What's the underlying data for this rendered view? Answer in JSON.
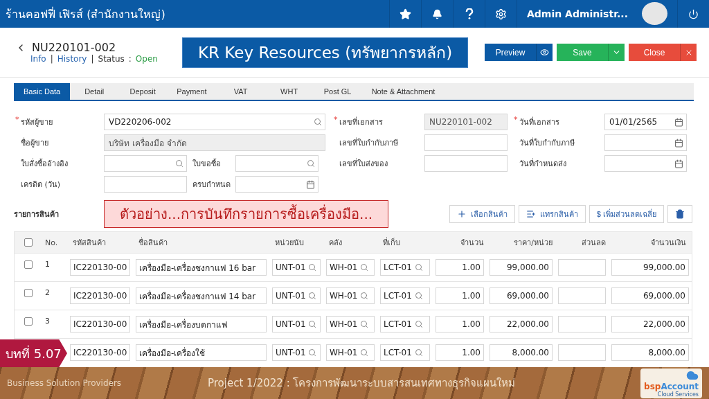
{
  "app_bar": {
    "company": "ร้านคอฟฟี่ เฟิรส์ (สำนักงานใหญ่)",
    "user": "Admin Administr..."
  },
  "header": {
    "doc_no": "NU220101-002",
    "links": [
      "Info",
      "History"
    ],
    "separator": "|",
    "status_label": "Status",
    "colon": ":",
    "status": "Open",
    "banner": "KR Key Resources (ทรัพยากรหลัก)",
    "buttons": [
      {
        "label": "Preview",
        "kind": "primary"
      },
      {
        "label": "Save",
        "kind": "success"
      },
      {
        "label": "Close",
        "kind": "danger"
      }
    ]
  },
  "tabs": [
    {
      "label": "Basic Data",
      "selected": true
    },
    {
      "label": "Detail",
      "selected": false
    },
    {
      "label": "Deposit",
      "selected": false
    },
    {
      "label": "Payment",
      "selected": false
    },
    {
      "label": "VAT",
      "selected": false
    },
    {
      "label": "WHT",
      "selected": false
    },
    {
      "label": "Post GL",
      "selected": false
    },
    {
      "label": "Note & Attachment",
      "selected": false
    }
  ],
  "form": {
    "required_mark": "*",
    "rows": [
      {
        "left": [
          {
            "label": "รหัสผู้ขาย",
            "value": "VD220206-002",
            "required": true,
            "readonly": false,
            "kind": "search"
          }
        ],
        "middle": {
          "label": "เลขที่เอกสาร",
          "value": "NU220101-002",
          "required": true,
          "readonly": true
        },
        "right": {
          "label": "วันที่เอกสาร",
          "value": "01/01/2565",
          "required": true,
          "readonly": false,
          "kind": "calendar"
        }
      },
      {
        "left": [
          {
            "label": "ชื่อผู้ขาย",
            "value": "บริษัท เครื่องมือ จำกัด",
            "required": false,
            "readonly": true
          }
        ],
        "middle": {
          "label": "เลขที่ใบกำกับภาษี",
          "required": false,
          "readonly": false
        },
        "right": {
          "label": "วันที่ใบกำกับภาษี",
          "required": false,
          "readonly": false,
          "kind": "calendar"
        }
      },
      {
        "left": [
          {
            "label": "ใบสั่งซื้ออ้างอิง",
            "required": false,
            "readonly": false,
            "kind": "search"
          },
          {
            "label": "ใบขอซื้อ",
            "required": false,
            "readonly": false,
            "kind": "search"
          }
        ],
        "middle": {
          "label": "เลขที่ใบส่งของ",
          "required": false,
          "readonly": false
        },
        "right": {
          "label": "วันที่กำหนดส่ง",
          "required": false,
          "readonly": false,
          "kind": "calendar"
        }
      },
      {
        "left": [
          {
            "label": "เครดิต (วัน)",
            "required": false,
            "readonly": false
          },
          {
            "label": "ครบกำหนด",
            "required": false,
            "readonly": false,
            "kind": "calendar"
          }
        ]
      }
    ]
  },
  "items": {
    "title": "รายการสินค้า",
    "note": "ตัวอย่าง...การบันทึกรายการซื้อเครื่องมือ...",
    "tools": [
      {
        "label": "เลือกสินค้า",
        "kind": "add"
      },
      {
        "label": "แทรกสินค้า",
        "kind": "insert"
      },
      {
        "label": "$ เพิ่มส่วนลดเฉลี่ย",
        "kind": "plain"
      },
      {
        "kind": "delete"
      }
    ],
    "select_all_checked": false,
    "columns": [
      "No.",
      "รหัสสินค้า",
      "ชื่อสินค้า",
      "หน่วยนับ",
      "คลัง",
      "ที่เก็บ",
      "จำนวน",
      "ราคา/หน่วย",
      "ส่วนลด",
      "จำนวนเงิน"
    ],
    "rows": [
      {
        "checked": false,
        "no": "1",
        "code": "IC220130-00",
        "name": "เครื่องมือ-เครื่องชงกาแฟ 16 bar",
        "unit": "UNT-01",
        "warehouse": "WH-01",
        "location": "LCT-01",
        "qty": "1.00",
        "price": "99,000.00",
        "amount": "99,000.00"
      },
      {
        "checked": false,
        "no": "2",
        "code": "IC220130-00",
        "name": "เครื่องมือ-เครื่องชงกาแฟ 14 bar",
        "unit": "UNT-01",
        "warehouse": "WH-01",
        "location": "LCT-01",
        "qty": "1.00",
        "price": "69,000.00",
        "amount": "69,000.00"
      },
      {
        "checked": false,
        "no": "3",
        "code": "IC220130-00",
        "name": "เครื่องมือ-เครื่องบดกาแฟ",
        "unit": "UNT-01",
        "warehouse": "WH-01",
        "location": "LCT-01",
        "qty": "1.00",
        "price": "22,000.00",
        "amount": "22,000.00"
      },
      {
        "code": "IC220130-00",
        "name": "เครื่องมือ-เครื่องใช้",
        "unit": "UNT-01",
        "warehouse": "WH-01",
        "location": "LCT-01",
        "qty": "1.00",
        "price": "8,000.00",
        "amount": "8,000.00"
      }
    ]
  },
  "lesson": "บทที่ 5.07",
  "footer": {
    "left": "Business Solution Providers",
    "center": "Project 1/2022 : โครงการพัฒนาระบบสารสนเทศทางธุรกิจแผนใหม่",
    "logo_a": "bsp",
    "logo_b": "Account",
    "logo_c": "Cloud Services"
  }
}
